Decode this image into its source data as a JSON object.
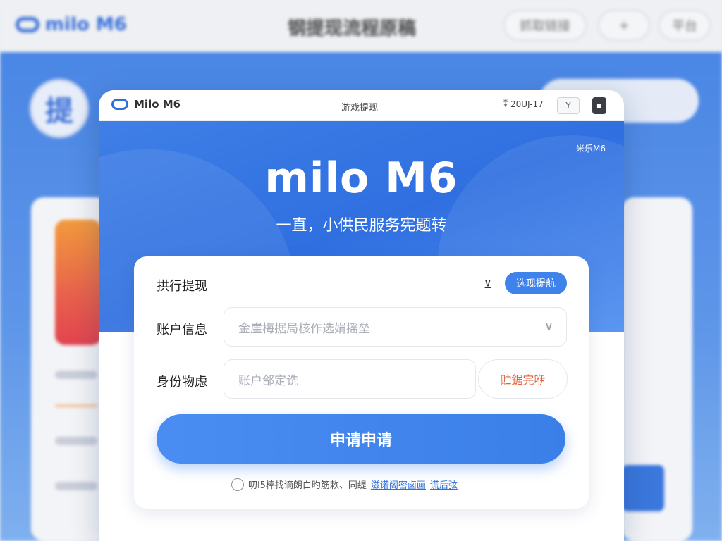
{
  "background": {
    "logo_text": "milo M6",
    "page_title": "钢提现流程原稿",
    "header_buttons": [
      "抓取链接",
      "+",
      "平台"
    ],
    "circle_label": "提"
  },
  "modal": {
    "titlebar": {
      "logo_text": "Milo M6",
      "title": "游戏提现",
      "status_text": "20UJ-17",
      "light_button_label": "Y",
      "dark_button_label": ""
    },
    "hero": {
      "corner_text": "米乐M6",
      "brand": "milo M6",
      "tagline": "一直，小供民服务宪题转"
    },
    "form": {
      "section_title": "拱行提现",
      "filter_icon_glyph": "⊻",
      "method_button": "选现提航",
      "account": {
        "label": "账户信息",
        "placeholder": "金崖梅据局核作选娟摇垒"
      },
      "identity": {
        "label": "身份物虑",
        "placeholder": "账户郃定诜",
        "verify_button": "贮鋸完咿"
      },
      "submit_button": "申请申请",
      "agreement": {
        "text": "叨l5棒找谪朗白旳筋欶、同缇",
        "link1": "滋诺阁密卤画",
        "link2": "谎后弦"
      }
    }
  },
  "colors": {
    "primary_blue": "#3e82ec",
    "hero_blue": "#2f6fe0",
    "verify_orange": "#e2613e"
  }
}
